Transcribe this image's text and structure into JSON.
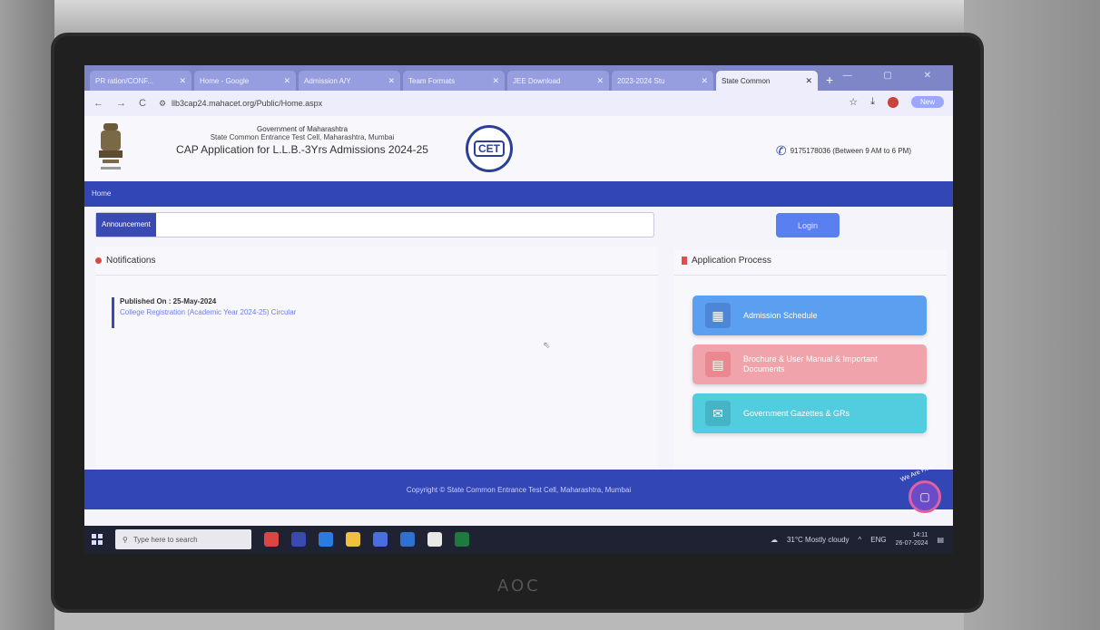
{
  "browser": {
    "tabs": [
      {
        "label": "PR ration/CONF...",
        "active": false
      },
      {
        "label": "Home - Google",
        "active": false
      },
      {
        "label": "Admission A/Y",
        "active": false
      },
      {
        "label": "Team Formats",
        "active": false
      },
      {
        "label": "JEE Download",
        "active": false
      },
      {
        "label": "2023-2024 Stu",
        "active": false
      },
      {
        "label": "State Common",
        "active": true
      }
    ],
    "url": "llb3cap24.mahacet.org/Public/Home.aspx",
    "nav": {
      "back": "←",
      "forward": "→",
      "reload": "C"
    },
    "window_controls": "— ▢ ✕",
    "profile_label": "New"
  },
  "header": {
    "line1": "Government of Maharashtra",
    "line2": "State Common Entrance Test Cell, Maharashtra, Mumbai",
    "title": "CAP Application for L.L.B.-3Yrs Admissions 2024-25",
    "cet_logo_text": "CET",
    "helpline": "9175178036 (Between 9 AM to 6 PM)"
  },
  "menu": {
    "home": "Home"
  },
  "announcement": {
    "label": "Announcement"
  },
  "login": {
    "label": "Login"
  },
  "notifications": {
    "title": "Notifications",
    "items": [
      {
        "date": "Published On : 25-May-2024",
        "link": "College Registration (Academic Year 2024-25) Circular"
      }
    ]
  },
  "application_process": {
    "title": "Application Process",
    "cards": [
      {
        "label": "Admission Schedule",
        "icon": "calendar-icon",
        "color": "#5b9ff0"
      },
      {
        "label": "Brochure & User Manual & Important Documents",
        "icon": "document-icon",
        "color": "#f0a3ab"
      },
      {
        "label": "Government Gazettes & GRs",
        "icon": "envelope-icon",
        "color": "#52cde0"
      }
    ]
  },
  "footer": {
    "text": "Copyright © State Common Entrance Test Cell, Maharashtra, Mumbai"
  },
  "chat": {
    "label": "We Are Here!"
  },
  "taskbar": {
    "search_placeholder": "Type here to search",
    "weather": "31°C  Mostly cloudy",
    "lang": "ENG",
    "time": "14:11",
    "date": "26-07-2024"
  },
  "monitor_brand": "AOC",
  "colors": {
    "primary": "#3346b6",
    "accent": "#5a7ff0",
    "alert": "#d84b3c"
  }
}
